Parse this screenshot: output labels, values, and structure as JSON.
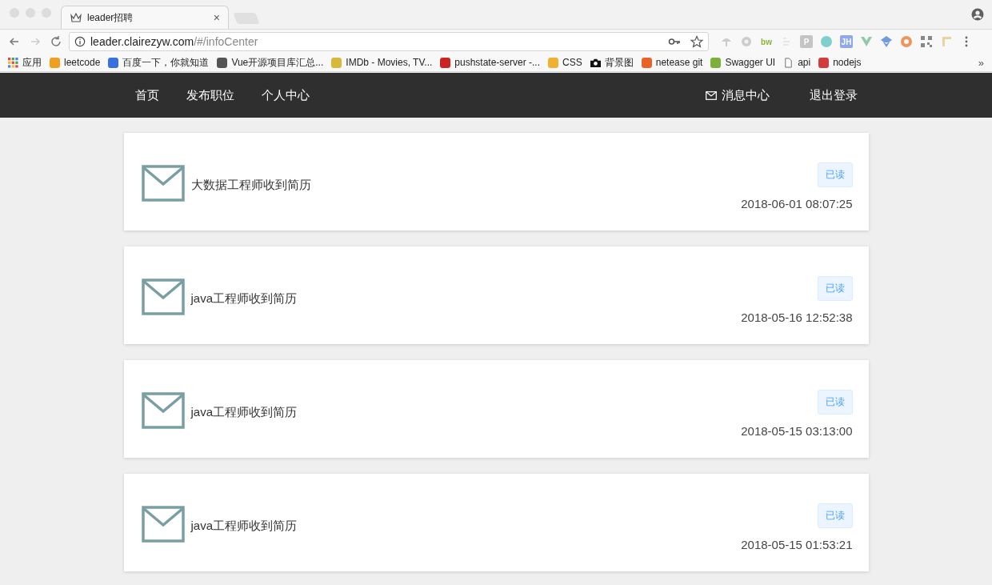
{
  "browser": {
    "tab_title": "leader招聘",
    "tab_close": "×",
    "url_host": "leader.clairezyw.com",
    "url_path": "/#/infoCenter",
    "extensions": [
      {
        "kind": "mushroom"
      },
      {
        "kind": "gear"
      },
      {
        "kind": "text",
        "label": "bw",
        "color": "#8db33a"
      },
      {
        "kind": "lines"
      },
      {
        "kind": "tile",
        "label": "P",
        "color": "#c4c4c4"
      },
      {
        "kind": "circle",
        "color": "#7fcfcf"
      },
      {
        "kind": "tile",
        "label": "JH",
        "color": "#8fa8e8"
      },
      {
        "kind": "vue"
      },
      {
        "kind": "diamond",
        "color": "#6f9be0"
      },
      {
        "kind": "ring",
        "color": "#f0955a"
      },
      {
        "kind": "qr"
      },
      {
        "kind": "pin"
      }
    ],
    "bookmarks": [
      {
        "label": "应用",
        "kind": "apps"
      },
      {
        "label": "leetcode",
        "kind": "fav",
        "color": "#f0a020"
      },
      {
        "label": "百度一下，你就知道",
        "kind": "fav",
        "color": "#3870e0"
      },
      {
        "label": "Vue开源项目库汇总...",
        "kind": "fav",
        "color": "#555555"
      },
      {
        "label": "IMDb - Movies, TV...",
        "kind": "fav",
        "color": "#d8b838"
      },
      {
        "label": "pushstate-server -...",
        "kind": "fav",
        "color": "#cc2222"
      },
      {
        "label": "CSS",
        "kind": "fav",
        "color": "#f0b030"
      },
      {
        "label": "背景图",
        "kind": "camera"
      },
      {
        "label": "netease git",
        "kind": "fav",
        "color": "#e8632a"
      },
      {
        "label": "Swagger UI",
        "kind": "fav",
        "color": "#7bb03a"
      },
      {
        "label": "api",
        "kind": "page"
      },
      {
        "label": "nodejs",
        "kind": "fav",
        "color": "#d23c3c"
      }
    ],
    "bookmarks_more": "»"
  },
  "nav": {
    "left": [
      {
        "label": "首页"
      },
      {
        "label": "发布职位"
      },
      {
        "label": "个人中心"
      }
    ],
    "right": [
      {
        "label": "消息中心",
        "kind": "mail"
      },
      {
        "label": "退出登录",
        "kind": "plain"
      }
    ]
  },
  "messages": [
    {
      "title": "大数据工程师收到简历",
      "status": "已读",
      "read": true,
      "time": "2018-06-01 08:07:25"
    },
    {
      "title": "java工程师收到简历",
      "status": "已读",
      "read": true,
      "time": "2018-05-16 12:52:38"
    },
    {
      "title": "java工程师收到简历",
      "status": "已读",
      "read": true,
      "time": "2018-05-15 03:13:00"
    },
    {
      "title": "java工程师收到简历",
      "status": "已读",
      "read": true,
      "time": "2018-05-15 01:53:21"
    }
  ]
}
